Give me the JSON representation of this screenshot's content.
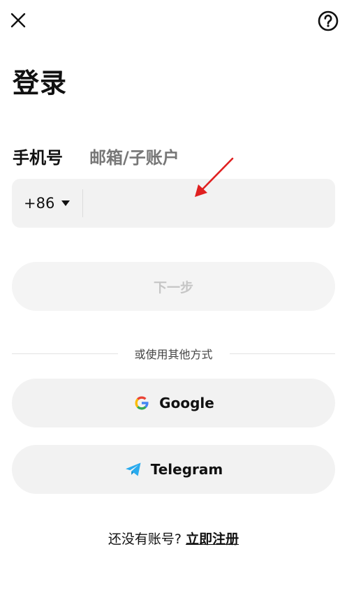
{
  "header": {
    "close_icon": "close-icon",
    "help_icon": "help-circle-icon"
  },
  "title": "登录",
  "tabs": [
    {
      "label": "手机号",
      "active": true
    },
    {
      "label": "邮箱/子账户",
      "active": false
    }
  ],
  "phone": {
    "country_code": "+86",
    "value": "",
    "placeholder": ""
  },
  "next_button": "下一步",
  "divider_text": "或使用其他方式",
  "social": {
    "google": "Google",
    "telegram": "Telegram"
  },
  "signup": {
    "prompt": "还没有账号?",
    "link": "立即注册"
  },
  "colors": {
    "field_bg": "#f2f2f2",
    "disabled_text": "#c6c6c6",
    "annotation_red": "#e02020",
    "telegram_blue": "#2aabee"
  }
}
